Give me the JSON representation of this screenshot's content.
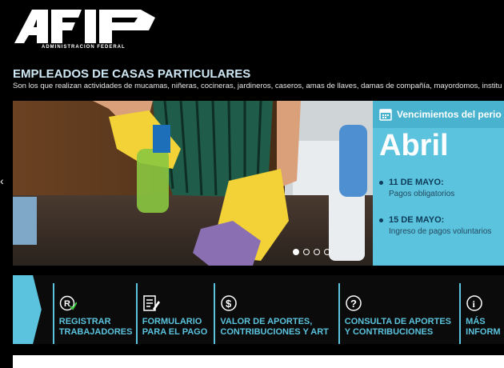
{
  "logo": {
    "wordmark": "AFIP",
    "tagline": "ADMINISTRACION FEDERAL"
  },
  "header": {
    "title": "EMPLEADOS DE CASAS PARTICULARES",
    "subtitle": "Son los que realizan actividades de mucamas, niñeras, cocineras, jardineros, caseros, amas de llaves, damas de compañía, mayordomos, institu"
  },
  "panel": {
    "heading": "Vencimientos del perio",
    "month": "Abril",
    "entries": [
      {
        "date": "11 DE MAYO:",
        "desc": "Pagos obligatorios"
      },
      {
        "date": "15 DE MAYO:",
        "desc": "Ingreso de pagos voluntarios"
      }
    ]
  },
  "nav": {
    "items": [
      {
        "label": "REGISTRAR\nTRABAJADORES",
        "icon": "registered-check-icon"
      },
      {
        "label": "FORMULARIO\nPARA EL PAGO",
        "icon": "form-edit-icon"
      },
      {
        "label": "VALOR DE APORTES,\nCONTRIBUCIONES Y ART",
        "icon": "dollar-circle-icon"
      },
      {
        "label": "CONSULTA DE APORTES\nY CONTRIBUCIONES",
        "icon": "question-circle-icon"
      },
      {
        "label": "MÁS\nINFORM",
        "icon": "info-circle-icon"
      }
    ]
  },
  "colors": {
    "accent": "#5bc3dd",
    "background": "#000000",
    "title": "#cfe8f5",
    "panel_text": "#0d3c5a"
  }
}
